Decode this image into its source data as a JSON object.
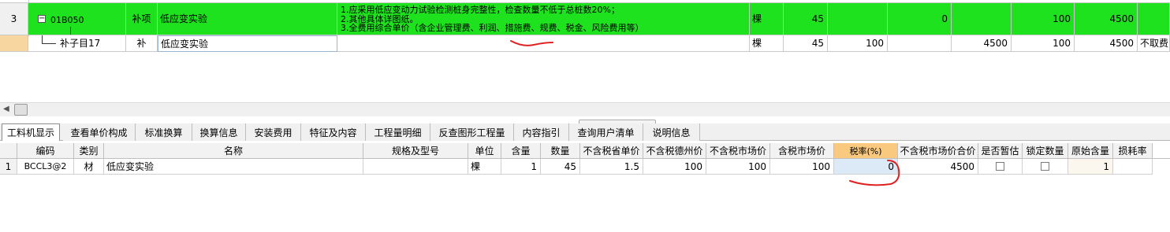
{
  "upper_grid": {
    "row1": {
      "index": "3",
      "tree_toggle": "−",
      "code": "01B050",
      "type": "补项",
      "name": "低应变实验",
      "description": [
        "1.应采用低应变动力试验检测桩身完整性，检查数量不低于总桩数20%；",
        "2.其他具体详图纸。",
        "3.全费用综合单价（含企业管理费、利润、措施费、规费、税金、风险费用等）"
      ],
      "unit": "棵",
      "qty": "45",
      "c1": "",
      "c2": "0",
      "c3": "",
      "c4": "100",
      "c5": "4500"
    },
    "row2": {
      "code": "补子目17",
      "type": "补",
      "name": "低应变实验",
      "unit": "棵",
      "qty": "45",
      "c1": "100",
      "c2": "",
      "c3": "4500",
      "c4": "100",
      "c5": "4500",
      "c6": "不取费"
    }
  },
  "tabs": [
    {
      "label": "工料机显示",
      "active": true
    },
    {
      "label": "查看单价构成"
    },
    {
      "label": "标准换算"
    },
    {
      "label": "换算信息"
    },
    {
      "label": "安装费用"
    },
    {
      "label": "特征及内容"
    },
    {
      "label": "工程量明细"
    },
    {
      "label": "反查图形工程量"
    },
    {
      "label": "内容指引"
    },
    {
      "label": "查询用户清单"
    },
    {
      "label": "说明信息"
    }
  ],
  "lower_grid": {
    "headers": [
      "编码",
      "类别",
      "名称",
      "规格及型号",
      "单位",
      "含量",
      "数量",
      "不含税省单价",
      "不含税德州价",
      "不含税市场价",
      "含税市场价",
      "税率(%)",
      "不含税市场价合价",
      "是否暂估",
      "锁定数量",
      "原始含量",
      "损耗率"
    ],
    "highlight_header": "税率(%)",
    "rows": [
      {
        "index": "1",
        "code": "BCCL3@2",
        "category": "材",
        "name": "低应变实验",
        "spec": "",
        "unit": "棵",
        "content": "1",
        "quantity": "45",
        "prov_price": "1.5",
        "dezhou_price": "100",
        "market_price": "100",
        "market_price_tax": "100",
        "tax_rate": "0",
        "market_total": "4500",
        "is_estimate": false,
        "lock_qty": false,
        "original_content": "1",
        "loss_rate": ""
      }
    ]
  },
  "colors": {
    "green_row": "#1de21d",
    "highlight_header": "#f8c97f",
    "annotation_red": "#e02020",
    "selected_cell": "#dce9f7"
  }
}
